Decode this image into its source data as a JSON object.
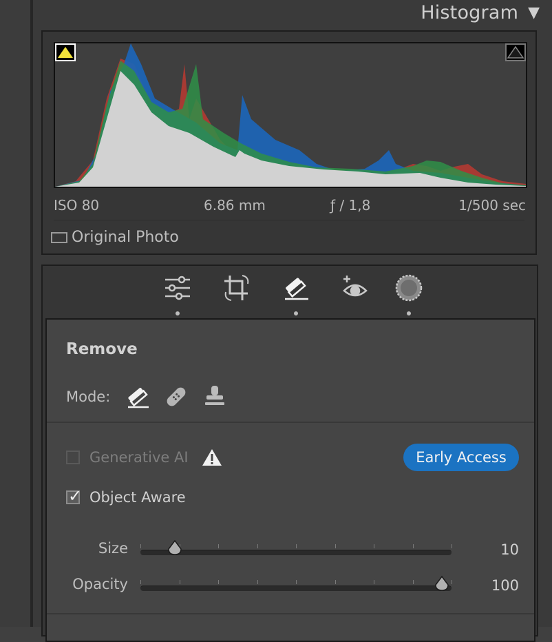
{
  "histogram": {
    "title": "Histogram",
    "toggle": "▼",
    "exif": {
      "iso": "ISO 80",
      "focal_length": "6.86 mm",
      "aperture": "ƒ / 1,8",
      "shutter": "1/500 sec"
    },
    "original_photo_label": "Original Photo"
  },
  "toolbar": {
    "tools": [
      "edit-sliders-icon",
      "crop-icon",
      "remove-eraser-icon",
      "red-eye-icon",
      "masking-icon"
    ],
    "active_tool": "remove-eraser-icon"
  },
  "remove": {
    "title": "Remove",
    "mode_label": "Mode:",
    "modes": [
      "eraser-icon",
      "heal-bandage-icon",
      "clone-stamp-icon"
    ],
    "generative_ai_label": "Generative AI",
    "generative_ai_checked": false,
    "early_access_label": "Early Access",
    "object_aware_label": "Object Aware",
    "object_aware_checked": true,
    "sliders": [
      {
        "label": "Size",
        "value": "10",
        "fraction": 0.11
      },
      {
        "label": "Opacity",
        "value": "100",
        "fraction": 0.97
      }
    ]
  },
  "colors": {
    "accent": "#1b73c2",
    "panel_bg": "#363636",
    "card_bg": "#454545"
  }
}
